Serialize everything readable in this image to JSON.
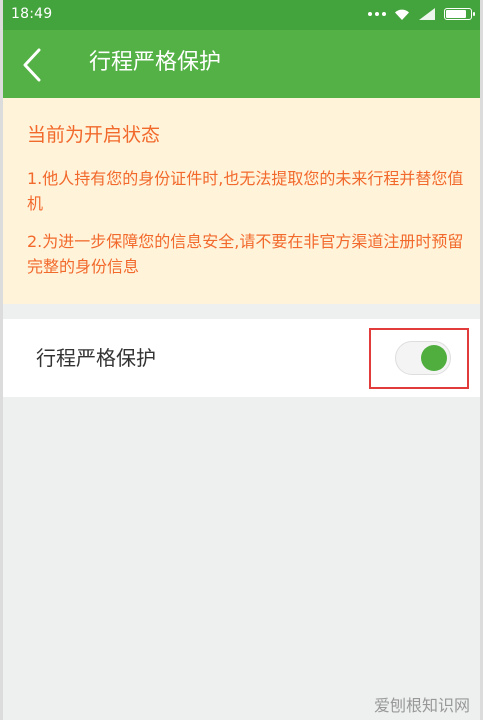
{
  "status_bar": {
    "time": "18:49"
  },
  "header": {
    "title": "行程严格保护",
    "back_icon": "chevron-left-icon"
  },
  "notice": {
    "heading": "当前为开启状态",
    "items": [
      "1.他人持有您的身份证件时,也无法提取您的未来行程并替您值机",
      "2.为进一步保障您的信息安全,请不要在非官方渠道注册时预留完整的身份信息"
    ]
  },
  "setting": {
    "label": "行程严格保护",
    "toggle_on": true
  },
  "watermark": "爱刨根知识网",
  "colors": {
    "status_bar": "#43a33c",
    "title_bar": "#54b145",
    "notice_bg": "#fff3da",
    "notice_text": "#f2692c",
    "toggle_on": "#4fae3e",
    "highlight": "#e23b3b"
  }
}
